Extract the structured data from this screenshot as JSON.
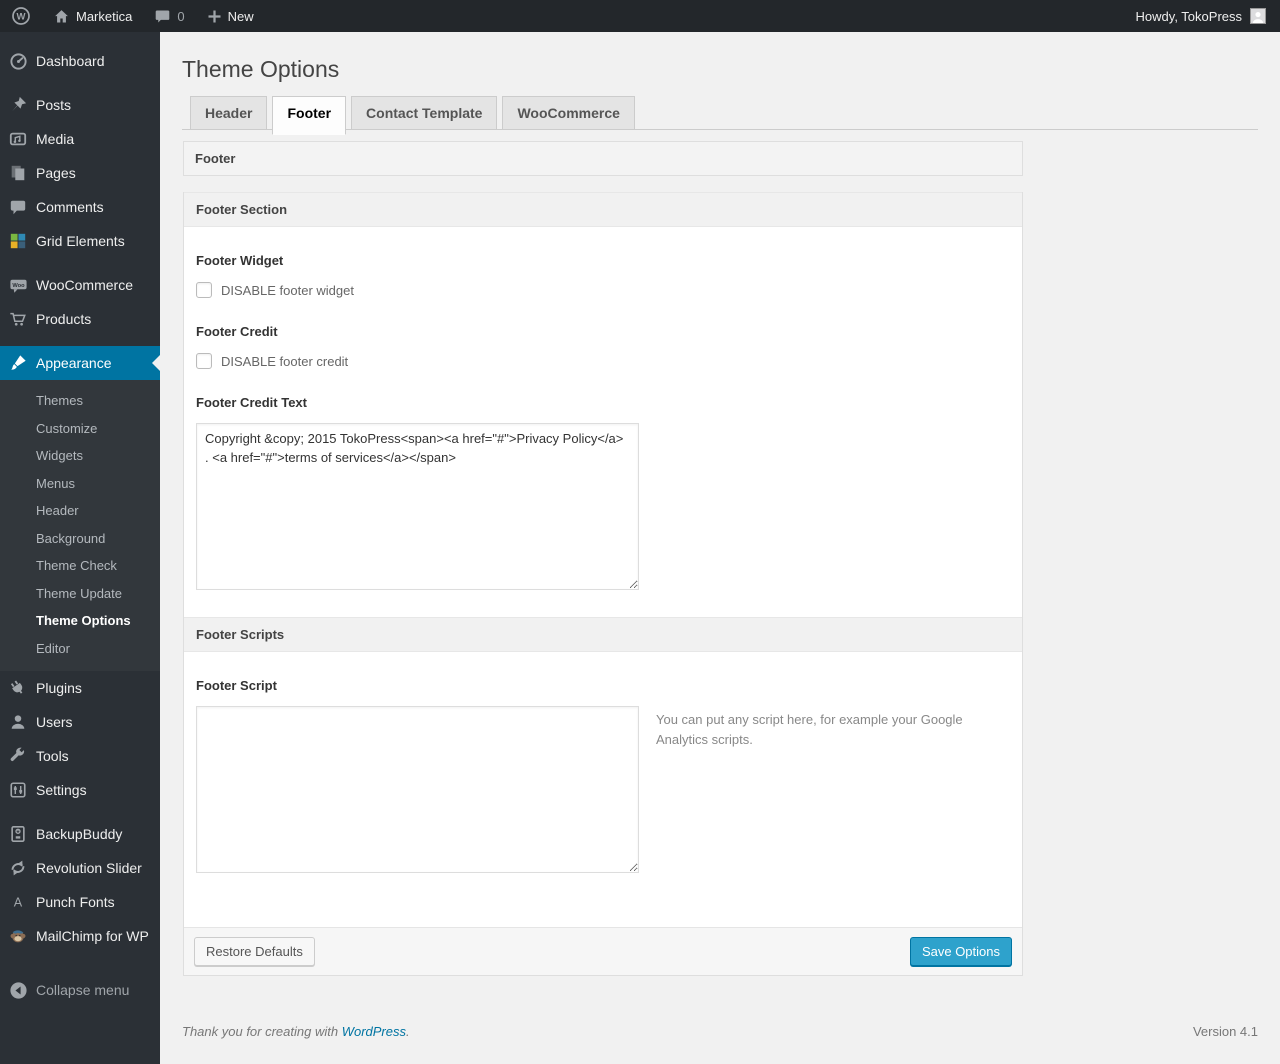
{
  "admin_bar": {
    "site_name": "Marketica",
    "comment_count": "0",
    "new_label": "New",
    "howdy": "Howdy, TokoPress"
  },
  "sidebar": {
    "items": [
      {
        "label": "Dashboard",
        "icon": "dashboard-icon"
      },
      {
        "label": "Posts",
        "icon": "pin-icon"
      },
      {
        "label": "Media",
        "icon": "media-icon"
      },
      {
        "label": "Pages",
        "icon": "pages-icon"
      },
      {
        "label": "Comments",
        "icon": "comments-icon"
      },
      {
        "label": "Grid Elements",
        "icon": "grid-elements-icon"
      },
      {
        "label": "WooCommerce",
        "icon": "woocommerce-icon"
      },
      {
        "label": "Products",
        "icon": "cart-icon"
      },
      {
        "label": "Appearance",
        "icon": "brush-icon",
        "current": true
      },
      {
        "label": "Plugins",
        "icon": "plugin-icon"
      },
      {
        "label": "Users",
        "icon": "user-icon"
      },
      {
        "label": "Tools",
        "icon": "wrench-icon"
      },
      {
        "label": "Settings",
        "icon": "settings-icon"
      },
      {
        "label": "BackupBuddy",
        "icon": "backup-icon"
      },
      {
        "label": "Revolution Slider",
        "icon": "refresh-icon"
      },
      {
        "label": "Punch Fonts",
        "icon": "letter-a-icon"
      },
      {
        "label": "MailChimp for WP",
        "icon": "monkey-icon"
      },
      {
        "label": "Collapse menu",
        "icon": "collapse-icon"
      }
    ],
    "appearance_submenu": [
      "Themes",
      "Customize",
      "Widgets",
      "Menus",
      "Header",
      "Background",
      "Theme Check",
      "Theme Update",
      "Theme Options",
      "Editor"
    ],
    "current_submenu_item": "Theme Options"
  },
  "main": {
    "page_title": "Theme Options",
    "tabs": [
      {
        "label": "Header",
        "active": false
      },
      {
        "label": "Footer",
        "active": true
      },
      {
        "label": "Contact Template",
        "active": false
      },
      {
        "label": "WooCommerce",
        "active": false
      }
    ],
    "panel": {
      "group_title": "Footer",
      "sections": [
        {
          "title": "Footer Section",
          "fields": [
            {
              "label": "Footer Widget",
              "checkbox_label": "DISABLE footer widget",
              "checked": false
            },
            {
              "label": "Footer Credit",
              "checkbox_label": "DISABLE footer credit",
              "checked": false
            },
            {
              "label": "Footer Credit Text",
              "value": "Copyright &copy; 2015 TokoPress<span><a href=\"#\">Privacy Policy</a> . <a href=\"#\">terms of services</a></span>"
            }
          ]
        },
        {
          "title": "Footer Scripts",
          "fields": [
            {
              "label": "Footer Script",
              "value": "",
              "description": "You can put any script here, for example your Google Analytics scripts."
            }
          ]
        }
      ],
      "buttons": {
        "restore": "Restore Defaults",
        "save": "Save Options"
      }
    },
    "page_footer": {
      "thanks_prefix": "Thank you for creating with",
      "wordpress_link": "WordPress",
      "thanks_suffix": ".",
      "version": "Version 4.1"
    }
  },
  "colors": {
    "adminbar_bg": "#23272b",
    "sidebar_bg": "#2b3036",
    "submenu_bg": "#32373c",
    "menu_highlight": "#0074a2",
    "primary_button_bg": "#2ea2cc",
    "primary_button_border": "#0074a2",
    "body_bg": "#f1f1f1"
  }
}
